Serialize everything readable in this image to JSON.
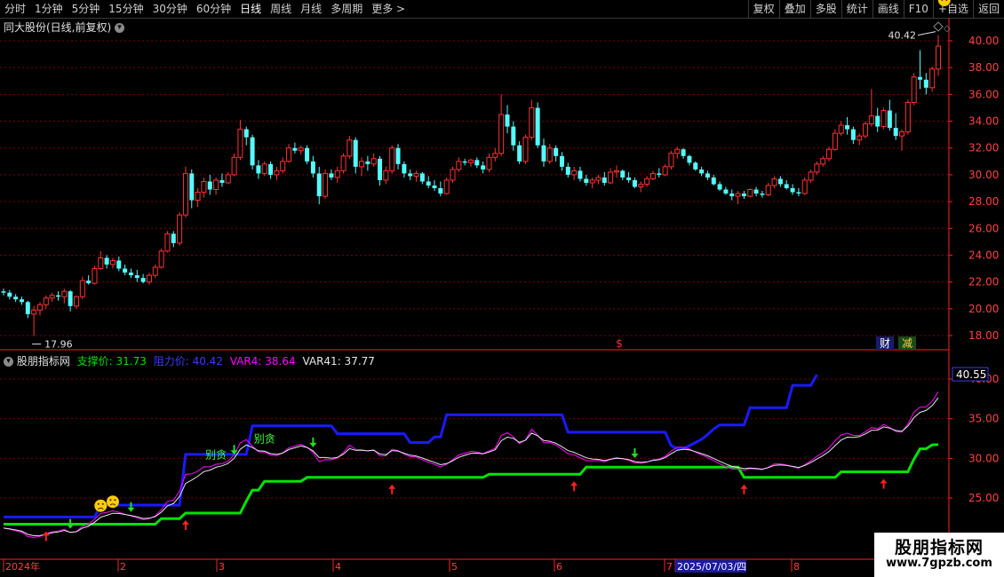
{
  "toolbar": {
    "periods": [
      "分时",
      "1分钟",
      "5分钟",
      "15分钟",
      "30分钟",
      "60分钟",
      "日线",
      "周线",
      "月线",
      "多周期",
      "更多 >"
    ],
    "active_period": "日线",
    "right_buttons": [
      "复权",
      "叠加",
      "多股",
      "统计",
      "画线",
      "F10",
      "+自选",
      "返回"
    ]
  },
  "main_panel": {
    "title": "同大股份(日线,前复权)",
    "last_price_label": "40.42",
    "low_label": "17.96",
    "s_marker": "$",
    "badge_cai": "财",
    "badge_jian": "减",
    "y_ticks": [
      "40.00",
      "38.00",
      "36.00",
      "34.00",
      "32.00",
      "30.00",
      "28.00",
      "26.00",
      "24.00",
      "22.00",
      "20.00",
      "18.00"
    ]
  },
  "indicator_panel": {
    "name": "股朋指标网",
    "support_label": "支撑价: 31.73",
    "resistance_label": "阻力价: 40.42",
    "var4_label": "VAR4: 38.64",
    "var41_label": "VAR41: 37.77",
    "value_box": "40.55",
    "y_ticks": [
      "40.00",
      "35.00",
      "30.00",
      "25.00"
    ],
    "annotations": [
      "别贪",
      "别贪"
    ]
  },
  "date_axis": {
    "labels": [
      "2024年",
      "2",
      "3",
      "4",
      "5",
      "6",
      "7",
      "2025/07/03/四",
      "8"
    ]
  },
  "watermark": {
    "title": "股朋指标网",
    "url": "www.7gpzb.com"
  },
  "colors": {
    "up": "#ff3232",
    "down": "#54fcfc",
    "resistance": "#1a1aff",
    "support": "#00e400",
    "var4": "#ff00ff",
    "var41": "#e8e8e8",
    "axis": "#ff2020",
    "grid": "#7a0000"
  },
  "chart_data": {
    "type": "candlestick",
    "ylim": [
      17,
      41
    ],
    "candles": [
      [
        21.3,
        21.5,
        21.0,
        21.2
      ],
      [
        21.2,
        21.4,
        20.7,
        20.9
      ],
      [
        20.9,
        21.1,
        20.5,
        20.7
      ],
      [
        20.7,
        20.9,
        20.3,
        20.5
      ],
      [
        20.5,
        20.6,
        19.3,
        19.6
      ],
      [
        19.6,
        20.2,
        17.96,
        19.9
      ],
      [
        19.9,
        20.5,
        19.5,
        20.3
      ],
      [
        20.3,
        21.0,
        20.0,
        20.8
      ],
      [
        20.8,
        21.2,
        20.5,
        21.0
      ],
      [
        21.0,
        21.3,
        20.6,
        20.9
      ],
      [
        20.9,
        21.5,
        20.4,
        21.3
      ],
      [
        21.3,
        21.4,
        19.8,
        20.2
      ],
      [
        20.2,
        21.0,
        20.0,
        20.9
      ],
      [
        20.9,
        22.4,
        20.7,
        22.1
      ],
      [
        22.1,
        22.5,
        21.8,
        21.9
      ],
      [
        21.9,
        23.2,
        21.8,
        23.0
      ],
      [
        23.0,
        24.3,
        22.9,
        23.8
      ],
      [
        23.8,
        24.0,
        23.0,
        23.3
      ],
      [
        23.3,
        23.8,
        23.0,
        23.6
      ],
      [
        23.6,
        23.9,
        22.8,
        23.0
      ],
      [
        23.0,
        23.3,
        22.5,
        22.7
      ],
      [
        22.7,
        23.0,
        22.3,
        22.5
      ],
      [
        22.5,
        22.9,
        22.0,
        22.3
      ],
      [
        22.3,
        22.6,
        21.9,
        22.0
      ],
      [
        22.0,
        22.7,
        21.8,
        22.5
      ],
      [
        22.5,
        23.3,
        22.3,
        23.1
      ],
      [
        23.1,
        24.5,
        23.0,
        24.3
      ],
      [
        24.3,
        25.8,
        24.2,
        25.6
      ],
      [
        25.6,
        25.8,
        24.6,
        24.9
      ],
      [
        24.9,
        27.2,
        24.7,
        27.0
      ],
      [
        27.0,
        30.6,
        26.8,
        30.1
      ],
      [
        30.1,
        30.4,
        27.5,
        28.1
      ],
      [
        28.1,
        29.0,
        27.6,
        28.7
      ],
      [
        28.7,
        29.8,
        28.3,
        29.5
      ],
      [
        29.5,
        30.0,
        28.5,
        28.9
      ],
      [
        28.9,
        29.8,
        28.5,
        29.6
      ],
      [
        29.6,
        30.1,
        29.1,
        29.4
      ],
      [
        29.4,
        30.2,
        29.3,
        30.0
      ],
      [
        30.0,
        31.6,
        29.9,
        31.3
      ],
      [
        31.3,
        34.1,
        31.1,
        33.4
      ],
      [
        33.4,
        33.6,
        32.2,
        32.8
      ],
      [
        32.8,
        33.0,
        30.4,
        30.7
      ],
      [
        30.7,
        31.1,
        29.7,
        30.1
      ],
      [
        30.1,
        31.0,
        29.9,
        30.8
      ],
      [
        30.8,
        31.0,
        29.7,
        30.0
      ],
      [
        30.0,
        30.6,
        29.6,
        30.3
      ],
      [
        30.3,
        31.3,
        30.1,
        31.0
      ],
      [
        31.0,
        32.3,
        30.9,
        32.0
      ],
      [
        32.0,
        32.4,
        31.6,
        31.8
      ],
      [
        31.8,
        32.2,
        31.5,
        32.0
      ],
      [
        32.0,
        32.2,
        30.8,
        31.0
      ],
      [
        31.0,
        31.4,
        29.8,
        30.1
      ],
      [
        30.1,
        30.6,
        27.8,
        28.4
      ],
      [
        28.4,
        30.4,
        28.2,
        30.1
      ],
      [
        30.1,
        30.4,
        29.6,
        29.8
      ],
      [
        29.8,
        30.6,
        29.4,
        30.3
      ],
      [
        30.3,
        31.6,
        30.1,
        31.4
      ],
      [
        31.4,
        32.9,
        31.2,
        32.6
      ],
      [
        32.6,
        32.8,
        30.1,
        30.6
      ],
      [
        30.6,
        31.3,
        29.9,
        31.0
      ],
      [
        31.0,
        31.4,
        30.3,
        30.8
      ],
      [
        30.8,
        31.6,
        30.6,
        31.2
      ],
      [
        31.2,
        31.4,
        29.2,
        29.6
      ],
      [
        29.6,
        30.6,
        29.3,
        30.3
      ],
      [
        30.3,
        32.2,
        30.1,
        32.0
      ],
      [
        32.0,
        32.3,
        30.4,
        30.8
      ],
      [
        30.8,
        31.0,
        29.8,
        30.1
      ],
      [
        30.1,
        30.4,
        29.6,
        29.9
      ],
      [
        29.9,
        30.3,
        29.5,
        30.1
      ],
      [
        30.1,
        30.2,
        29.3,
        29.5
      ],
      [
        29.5,
        29.9,
        29.0,
        29.2
      ],
      [
        29.2,
        29.6,
        28.8,
        29.0
      ],
      [
        29.0,
        29.5,
        28.4,
        28.6
      ],
      [
        28.6,
        29.8,
        28.5,
        29.6
      ],
      [
        29.6,
        30.6,
        29.4,
        30.4
      ],
      [
        30.4,
        31.3,
        30.2,
        31.0
      ],
      [
        31.0,
        31.2,
        30.7,
        30.9
      ],
      [
        30.9,
        31.2,
        30.6,
        31.1
      ],
      [
        31.1,
        31.3,
        30.5,
        30.7
      ],
      [
        30.7,
        31.0,
        30.1,
        30.4
      ],
      [
        30.4,
        31.6,
        30.2,
        31.3
      ],
      [
        31.3,
        32.0,
        31.0,
        31.6
      ],
      [
        31.6,
        36.0,
        31.4,
        34.5
      ],
      [
        34.5,
        35.2,
        33.1,
        33.6
      ],
      [
        33.6,
        34.0,
        31.8,
        32.2
      ],
      [
        32.2,
        32.5,
        30.8,
        31.0
      ],
      [
        31.0,
        33.0,
        30.8,
        32.8
      ],
      [
        32.8,
        35.6,
        32.6,
        35.0
      ],
      [
        35.0,
        35.4,
        32.0,
        32.2
      ],
      [
        32.2,
        32.7,
        30.6,
        31.0
      ],
      [
        31.0,
        32.3,
        30.8,
        32.0
      ],
      [
        32.0,
        32.2,
        31.0,
        31.4
      ],
      [
        31.4,
        31.7,
        30.3,
        30.6
      ],
      [
        30.6,
        30.9,
        29.8,
        30.0
      ],
      [
        30.0,
        30.6,
        29.6,
        30.3
      ],
      [
        30.3,
        30.6,
        29.5,
        29.7
      ],
      [
        29.7,
        30.0,
        29.2,
        29.4
      ],
      [
        29.4,
        29.8,
        29.0,
        29.6
      ],
      [
        29.6,
        30.0,
        29.3,
        29.8
      ],
      [
        29.8,
        30.2,
        29.2,
        29.4
      ],
      [
        29.4,
        30.5,
        29.3,
        30.2
      ],
      [
        30.2,
        30.7,
        29.8,
        30.3
      ],
      [
        30.3,
        30.4,
        29.6,
        29.8
      ],
      [
        29.8,
        30.2,
        29.4,
        29.6
      ],
      [
        29.6,
        29.8,
        29.0,
        29.1
      ],
      [
        29.1,
        29.5,
        28.7,
        29.3
      ],
      [
        29.3,
        29.9,
        29.1,
        29.7
      ],
      [
        29.7,
        30.3,
        29.6,
        30.1
      ],
      [
        30.1,
        30.5,
        29.8,
        30.0
      ],
      [
        30.0,
        30.8,
        29.9,
        30.6
      ],
      [
        30.6,
        31.8,
        30.4,
        31.6
      ],
      [
        31.6,
        32.1,
        31.2,
        31.9
      ],
      [
        31.9,
        32.0,
        31.2,
        31.4
      ],
      [
        31.4,
        31.5,
        30.7,
        30.9
      ],
      [
        30.9,
        31.0,
        30.3,
        30.4
      ],
      [
        30.4,
        30.6,
        29.9,
        30.1
      ],
      [
        30.1,
        30.3,
        29.6,
        29.8
      ],
      [
        29.8,
        30.0,
        29.2,
        29.3
      ],
      [
        29.3,
        29.5,
        28.8,
        28.9
      ],
      [
        28.9,
        29.1,
        28.5,
        28.6
      ],
      [
        28.6,
        28.9,
        28.1,
        28.4
      ],
      [
        28.4,
        28.8,
        27.8,
        28.6
      ],
      [
        28.6,
        28.8,
        28.2,
        28.4
      ],
      [
        28.4,
        29.0,
        28.3,
        28.9
      ],
      [
        28.9,
        29.1,
        28.4,
        28.6
      ],
      [
        28.6,
        28.8,
        28.3,
        28.5
      ],
      [
        28.5,
        29.4,
        28.4,
        29.2
      ],
      [
        29.2,
        29.9,
        29.0,
        29.7
      ],
      [
        29.7,
        29.9,
        29.1,
        29.3
      ],
      [
        29.3,
        29.6,
        28.9,
        29.0
      ],
      [
        29.0,
        29.3,
        28.5,
        28.7
      ],
      [
        28.7,
        29.0,
        28.4,
        28.6
      ],
      [
        28.6,
        29.8,
        28.5,
        29.6
      ],
      [
        29.6,
        30.4,
        29.4,
        30.2
      ],
      [
        30.2,
        31.0,
        30.0,
        30.8
      ],
      [
        30.8,
        31.4,
        30.6,
        31.2
      ],
      [
        31.2,
        32.1,
        31.0,
        31.9
      ],
      [
        31.9,
        33.4,
        31.8,
        33.1
      ],
      [
        33.1,
        34.0,
        32.9,
        33.7
      ],
      [
        33.7,
        34.3,
        33.0,
        33.4
      ],
      [
        33.4,
        33.6,
        32.3,
        32.6
      ],
      [
        32.6,
        33.1,
        32.2,
        32.9
      ],
      [
        32.9,
        34.0,
        32.7,
        33.8
      ],
      [
        33.8,
        36.4,
        33.6,
        34.4
      ],
      [
        34.4,
        35.0,
        33.2,
        33.6
      ],
      [
        33.6,
        35.0,
        33.4,
        34.8
      ],
      [
        34.8,
        35.6,
        33.3,
        33.5
      ],
      [
        33.5,
        34.6,
        32.6,
        32.9
      ],
      [
        32.9,
        33.4,
        31.8,
        33.2
      ],
      [
        33.2,
        35.6,
        33.0,
        35.4
      ],
      [
        35.4,
        37.6,
        35.2,
        37.3
      ],
      [
        37.3,
        39.3,
        36.4,
        37.1
      ],
      [
        37.1,
        37.6,
        36.0,
        36.5
      ],
      [
        36.5,
        38.1,
        36.2,
        37.9
      ],
      [
        37.9,
        40.42,
        37.4,
        39.6
      ]
    ],
    "ind_ylim": [
      20.5,
      41.5
    ],
    "resistance": [
      22.6,
      22.6,
      22.6,
      22.6,
      22.6,
      22.6,
      22.6,
      22.6,
      22.6,
      22.6,
      22.6,
      22.6,
      22.6,
      22.6,
      22.6,
      22.6,
      24.1,
      24.1,
      24.1,
      24.1,
      24.1,
      24.1,
      24.1,
      24.1,
      24.1,
      24.1,
      24.1,
      24.1,
      24.1,
      24.1,
      30.5,
      30.5,
      30.5,
      30.5,
      30.5,
      30.5,
      30.5,
      30.5,
      30.5,
      30.5,
      30.5,
      34.1,
      34.1,
      34.1,
      34.1,
      34.1,
      34.1,
      34.1,
      34.1,
      34.1,
      34.1,
      34.1,
      34.1,
      34.1,
      34.1,
      33.1,
      33.1,
      33.1,
      33.1,
      33.1,
      33.1,
      33.1,
      33.1,
      33.1,
      33.1,
      33.1,
      33.1,
      32.0,
      32.0,
      32.0,
      32.0,
      32.7,
      32.7,
      35.5,
      35.5,
      35.5,
      35.5,
      35.5,
      35.5,
      35.5,
      35.5,
      35.5,
      35.5,
      35.5,
      35.5,
      35.5,
      35.5,
      35.5,
      35.5,
      35.5,
      35.5,
      35.5,
      35.5,
      33.3,
      33.3,
      33.3,
      33.3,
      33.3,
      33.3,
      33.3,
      33.3,
      33.3,
      33.3,
      33.3,
      33.3,
      33.3,
      33.3,
      33.3,
      33.3,
      33.3,
      31.6,
      31.2,
      31.2,
      31.6,
      32.0,
      32.4,
      33.0,
      33.7,
      34.2,
      34.2,
      34.2,
      34.2,
      34.2,
      36.4,
      36.4,
      36.4,
      36.4,
      36.4,
      36.4,
      36.4,
      39.2,
      39.2,
      39.2,
      39.2,
      40.55
    ],
    "support": [
      21.7,
      21.7,
      21.7,
      21.7,
      21.7,
      21.7,
      21.7,
      21.7,
      21.7,
      21.7,
      21.7,
      21.7,
      21.7,
      21.7,
      21.7,
      21.7,
      21.7,
      21.7,
      21.7,
      21.7,
      21.7,
      21.7,
      21.7,
      21.7,
      21.7,
      21.7,
      22.4,
      22.4,
      22.4,
      22.4,
      23.1,
      23.1,
      23.1,
      23.1,
      23.1,
      23.1,
      23.1,
      23.1,
      23.1,
      23.1,
      24.6,
      26.0,
      26.0,
      27.1,
      27.1,
      27.1,
      27.1,
      27.1,
      27.1,
      27.1,
      27.6,
      27.6,
      27.6,
      27.6,
      27.6,
      27.6,
      27.6,
      27.6,
      27.6,
      27.6,
      27.6,
      27.6,
      27.6,
      27.6,
      27.6,
      27.6,
      27.6,
      27.6,
      27.6,
      27.6,
      27.6,
      27.6,
      27.6,
      27.6,
      27.6,
      27.6,
      27.6,
      27.6,
      27.6,
      27.6,
      28.0,
      28.0,
      28.0,
      28.0,
      28.0,
      28.0,
      28.0,
      28.0,
      28.0,
      28.0,
      28.0,
      28.0,
      28.0,
      28.0,
      28.0,
      28.0,
      28.9,
      28.9,
      28.9,
      28.9,
      28.9,
      28.9,
      28.9,
      28.9,
      28.9,
      28.9,
      28.9,
      28.9,
      28.9,
      28.9,
      28.9,
      28.9,
      28.9,
      28.9,
      28.9,
      28.9,
      28.9,
      28.9,
      28.9,
      28.9,
      28.9,
      28.9,
      27.6,
      27.6,
      27.6,
      27.6,
      27.6,
      27.6,
      27.6,
      27.6,
      27.6,
      27.6,
      27.6,
      27.6,
      27.6,
      27.6,
      27.6,
      27.6,
      28.3,
      28.3,
      28.3,
      28.3,
      28.3,
      28.3,
      28.3,
      28.3,
      28.3,
      28.3,
      28.3,
      28.3,
      29.9,
      31.2,
      31.2,
      31.7,
      31.73
    ],
    "up_arrows": [
      7,
      30,
      64,
      94,
      122,
      145
    ],
    "down_arrows": [
      11,
      21,
      38,
      51,
      104,
      155
    ],
    "faces": [
      16,
      18,
      155
    ],
    "bietan": [
      {
        "i": 35,
        "text_key": 0
      },
      {
        "i": 43,
        "text_key": 1
      }
    ]
  }
}
